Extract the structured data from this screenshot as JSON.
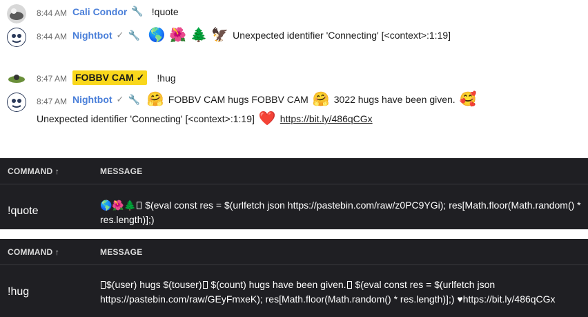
{
  "chat": {
    "messages": [
      {
        "time": "8:44 AM",
        "user": "Cali Condor",
        "text": "!quote"
      },
      {
        "time": "8:44 AM",
        "user": "Nightbot",
        "emojis": "🌎 🌺 🌲 🦅",
        "text": "Unexpected identifier 'Connecting' [<context>:1:19]"
      },
      {
        "time": "8:47 AM",
        "user": "FOBBV CAM",
        "text": "!hug"
      },
      {
        "time": "8:47 AM",
        "user": "Nightbot",
        "text1": "FOBBV CAM hugs FOBBV CAM",
        "text2": "3022 hugs have been given.",
        "text3": "Unexpected identifier 'Connecting' [<context>:1:19]",
        "link": "https://bit.ly/486qCGx"
      }
    ]
  },
  "table1": {
    "col_command": "COMMAND ↑",
    "col_message": "MESSAGE",
    "command": "!quote",
    "message_prefix": "🌎🌺🌲",
    "message": "$(eval const res = $(urlfetch json https://pastebin.com/raw/z0PC9YGi); res[Math.floor(Math.random() * res.length)];)"
  },
  "table2": {
    "col_command": "COMMAND ↑",
    "col_message": "MESSAGE",
    "command": "!hug",
    "message_a": "$(user) hugs $(touser)",
    "message_b": "$(count) hugs have been given.",
    "message_c": "$(eval const res = $(urlfetch json https://pastebin.com/raw/GEyFmxeK); res[Math.floor(Math.random() * res.length)];)",
    "message_d": "♥https://bit.ly/486qCGx"
  },
  "colors": {
    "username": "#4a7fd9",
    "highlight": "#f9d71c",
    "table_bg": "#1f1f23"
  }
}
